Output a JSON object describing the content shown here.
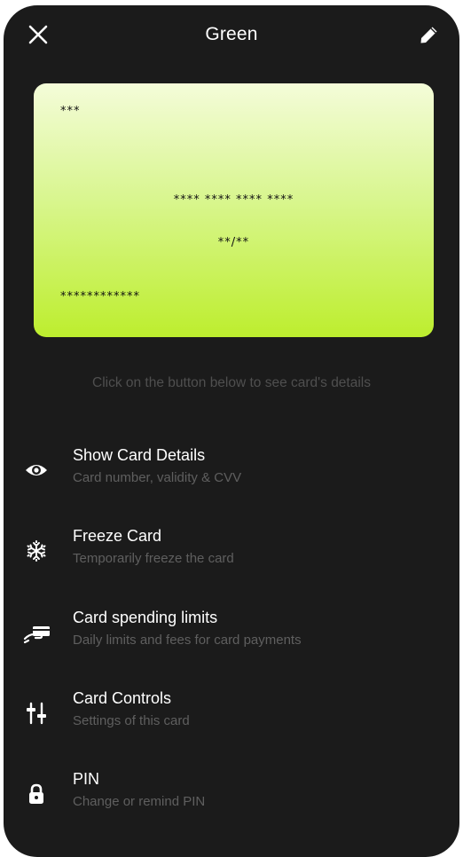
{
  "header": {
    "title": "Green",
    "close_icon": "close-icon",
    "edit_icon": "pencil-icon"
  },
  "card": {
    "cvv": "***",
    "number": "**** **** **** ****",
    "expiry": "**/**",
    "holder": "************",
    "gradient_top": "#f4fcd9",
    "gradient_bottom": "#bdee2e"
  },
  "hint": "Click on the button below to see card's details",
  "menu": [
    {
      "icon": "eye-icon",
      "label": "Show Card Details",
      "sub": "Card number, validity & CVV"
    },
    {
      "icon": "snowflake-icon",
      "label": "Freeze Card",
      "sub": "Temporarily freeze the card"
    },
    {
      "icon": "hand-card-icon",
      "label": "Card spending limits",
      "sub": "Daily limits and fees for card payments"
    },
    {
      "icon": "sliders-icon",
      "label": "Card Controls",
      "sub": "Settings of this card"
    },
    {
      "icon": "lock-icon",
      "label": "PIN",
      "sub": "Change or remind PIN"
    }
  ],
  "colors": {
    "background": "#1b1b1b",
    "text": "#ffffff",
    "muted": "#5f5f5f"
  }
}
